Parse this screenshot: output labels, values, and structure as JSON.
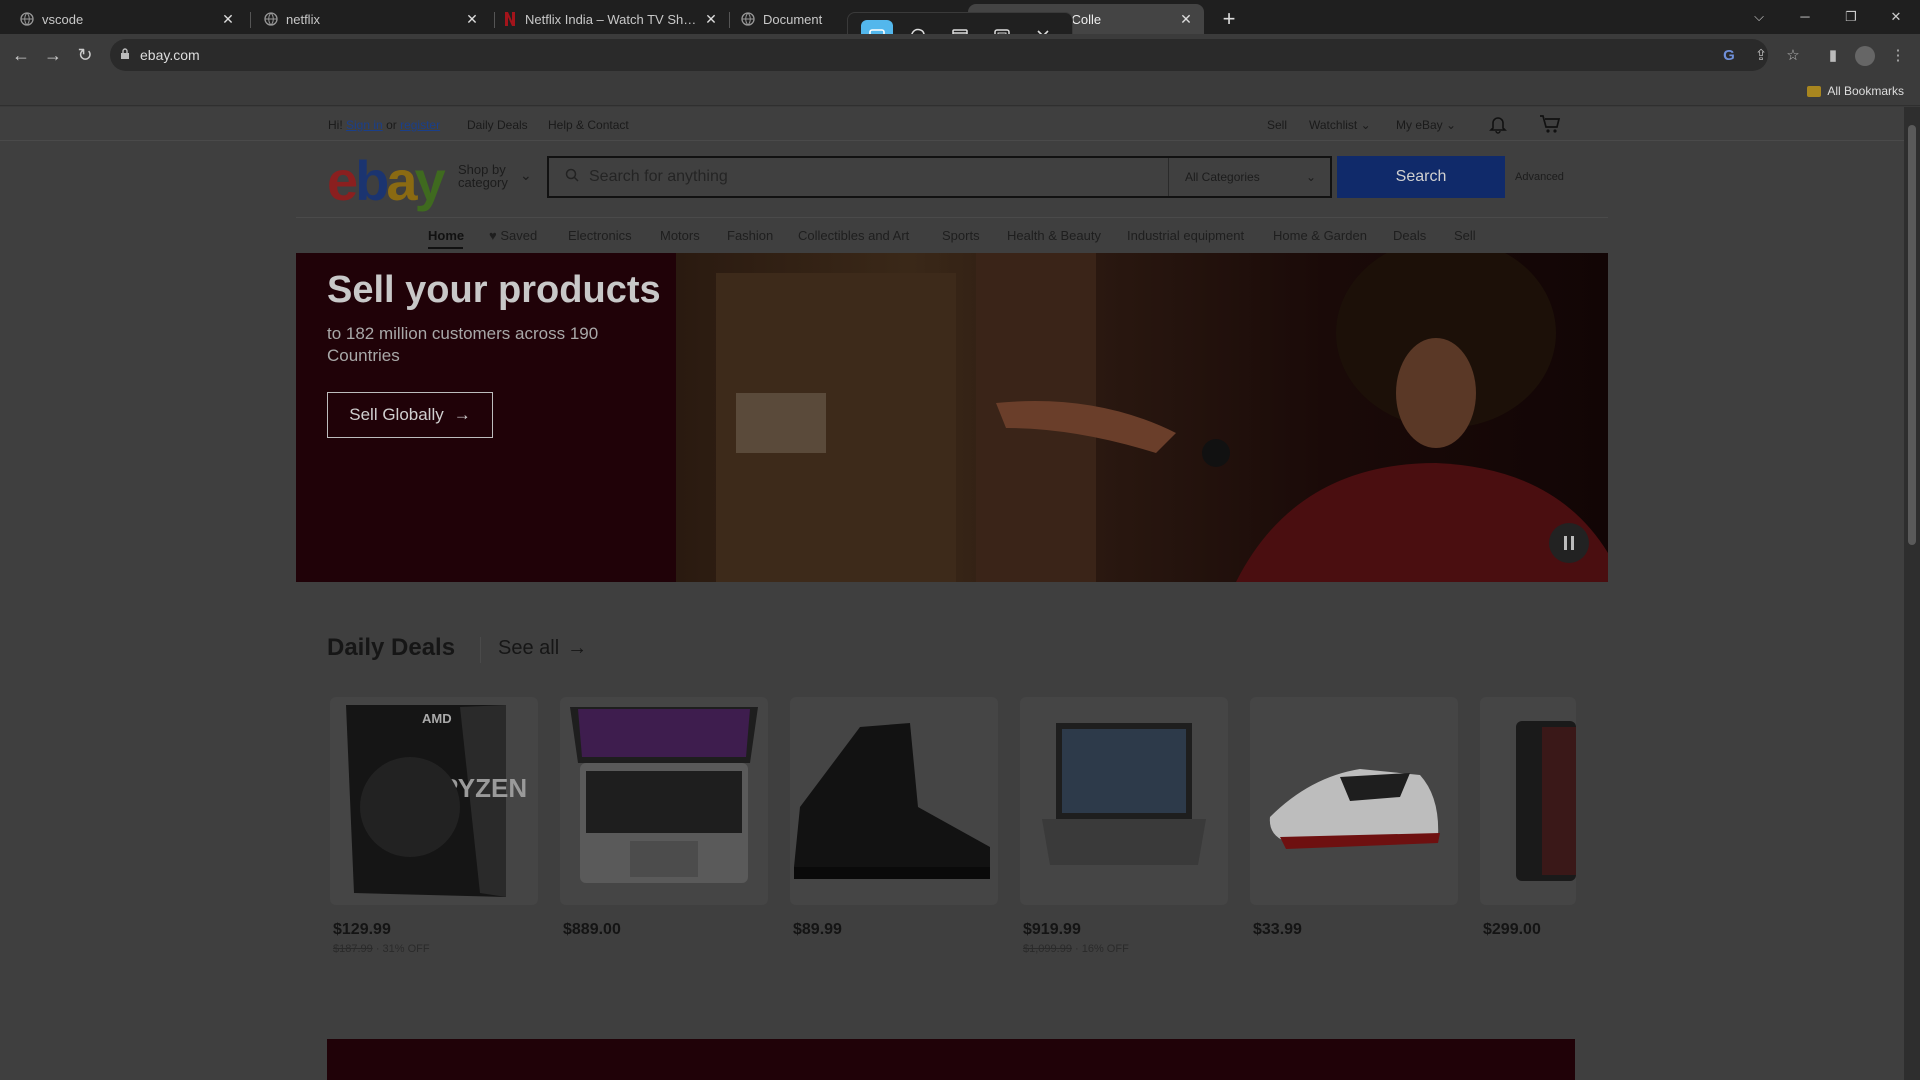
{
  "browser": {
    "tabs": [
      {
        "title": "vscode",
        "favicon": "globe-icon"
      },
      {
        "title": "netflix",
        "favicon": "globe-icon"
      },
      {
        "title": "Netflix India – Watch TV Shows",
        "favicon": "netflix-icon"
      },
      {
        "title": "Document",
        "favicon": "globe-icon"
      },
      {
        "title": "rs, Fashion, Colle",
        "favicon": "ebay-icon"
      }
    ],
    "url": "ebay.com",
    "bookmarks_all": "All Bookmarks"
  },
  "header": {
    "greeting_prefix": "Hi!",
    "sign_in": "Sign in",
    "or": "or",
    "register": "register",
    "daily_deals": "Daily Deals",
    "help_contact": "Help & Contact",
    "sell": "Sell",
    "watchlist": "Watchlist",
    "my_ebay": "My eBay"
  },
  "search": {
    "shop_by": "Shop by",
    "category": "category",
    "placeholder": "Search for anything",
    "category_selected": "All Categories",
    "button": "Search",
    "advanced": "Advanced"
  },
  "catnav": [
    "Home",
    "Saved",
    "Electronics",
    "Motors",
    "Fashion",
    "Collectibles and Art",
    "Sports",
    "Health & Beauty",
    "Industrial equipment",
    "Home & Garden",
    "Deals",
    "Sell"
  ],
  "hero": {
    "title": "Sell your products",
    "subtitle": "to 182 million customers across 190 Countries",
    "cta": "Sell Globally"
  },
  "deals": {
    "title": "Daily Deals",
    "see_all": "See all",
    "items": [
      {
        "price": "$129.99",
        "original": "$187.99",
        "discount": "31% OFF",
        "image": "amd-ryzen-box"
      },
      {
        "price": "$889.00",
        "original": "",
        "discount": "",
        "image": "macbook"
      },
      {
        "price": "$89.99",
        "original": "",
        "discount": "",
        "image": "black-boot"
      },
      {
        "price": "$919.99",
        "original": "$1,099.99",
        "discount": "16% OFF",
        "image": "gaming-laptop"
      },
      {
        "price": "$33.99",
        "original": "",
        "discount": "",
        "image": "puma-sneaker"
      },
      {
        "price": "$299.00",
        "original": "",
        "discount": "",
        "image": "tablet"
      }
    ]
  }
}
